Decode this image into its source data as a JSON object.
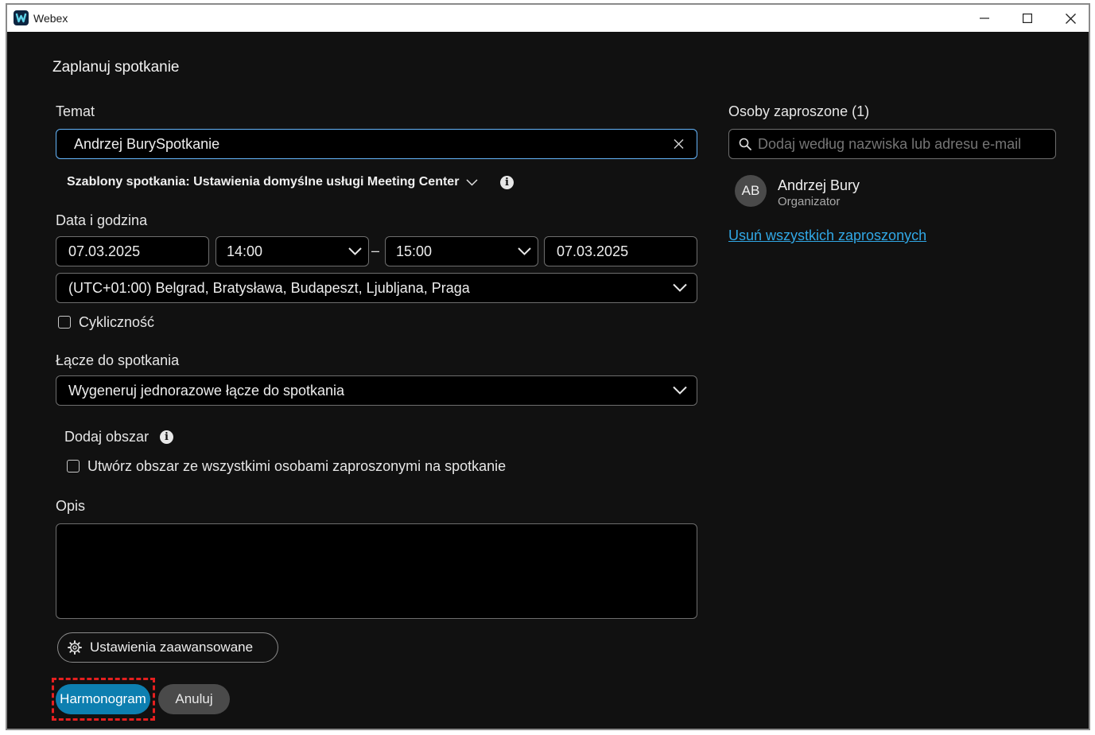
{
  "window": {
    "app_title": "Webex"
  },
  "dialog": {
    "title": "Zaplanuj spotkanie"
  },
  "topic": {
    "label": "Temat",
    "value": "Andrzej BurySpotkanie"
  },
  "templates": {
    "text": "Szablony spotkania: Ustawienia domyślne usługi Meeting Center"
  },
  "datetime": {
    "label": "Data i godzina",
    "start_date": "07.03.2025",
    "start_time": "14:00",
    "separator": "–",
    "end_time": "15:00",
    "end_date": "07.03.2025",
    "timezone": "(UTC+01:00) Belgrad, Bratysława, Budapeszt, Ljubljana, Praga",
    "recurrence_label": "Cykliczność"
  },
  "meeting_link": {
    "label": "Łącze do spotkania",
    "value": "Wygeneruj jednorazowe łącze do spotkania"
  },
  "space": {
    "label": "Dodaj obszar",
    "checkbox_label": "Utwórz obszar ze wszystkimi osobami zaproszonymi na spotkanie"
  },
  "description": {
    "label": "Opis",
    "value": ""
  },
  "advanced": {
    "label": "Ustawienia zaawansowane"
  },
  "actions": {
    "schedule_label": "Harmonogram",
    "cancel_label": "Anuluj"
  },
  "invitees": {
    "title": "Osoby zaproszone (1)",
    "search_placeholder": "Dodaj według nazwiska lub adresu e-mail",
    "people": [
      {
        "initials": "AB",
        "name": "Andrzej Bury",
        "role": "Organizator"
      }
    ],
    "remove_all_label": "Usuń wszystkich zaproszonych"
  },
  "colors": {
    "background": "#111111",
    "field_background": "#000000",
    "focus_border": "#64b4fa",
    "primary_button": "#0d7fb0",
    "link": "#31a8e6",
    "highlight_annotation": "#e51f1f"
  }
}
